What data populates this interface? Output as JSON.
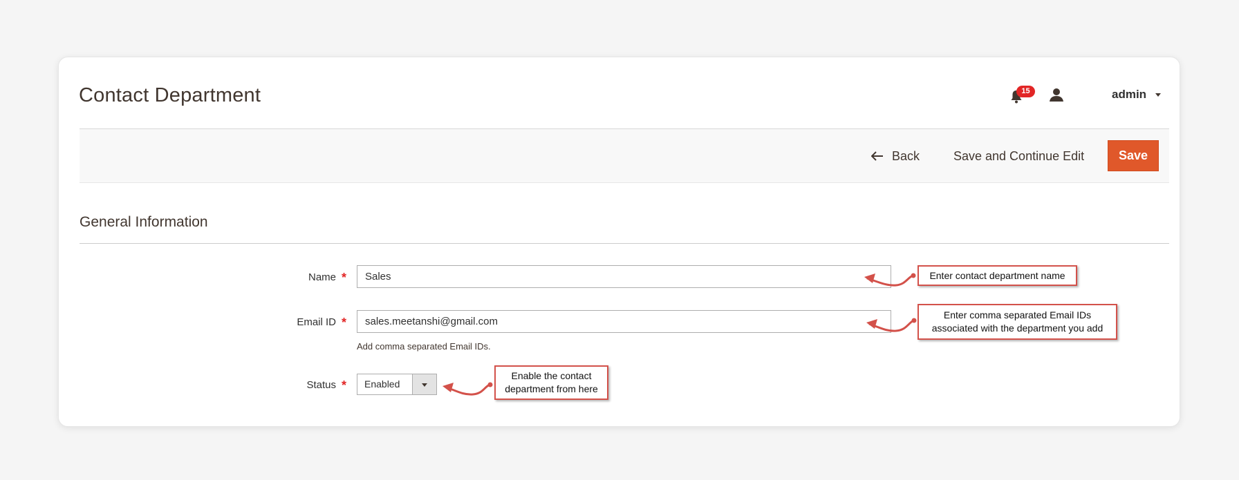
{
  "header": {
    "title": "Contact Department",
    "notifications_count": "15",
    "user_name": "admin"
  },
  "toolbar": {
    "back_label": "Back",
    "save_continue_label": "Save and Continue Edit",
    "save_label": "Save"
  },
  "section": {
    "title": "General Information"
  },
  "form": {
    "name": {
      "label": "Name",
      "value": "Sales"
    },
    "email": {
      "label": "Email ID",
      "value": "sales.meetanshi@gmail.com",
      "note": "Add comma separated Email IDs."
    },
    "status": {
      "label": "Status",
      "value": "Enabled"
    },
    "required_marker": "*"
  },
  "callouts": {
    "name": "Enter contact department name",
    "email_line1": "Enter comma separated Email IDs",
    "email_line2": "associated with the department you add",
    "status_line1": "Enable the contact",
    "status_line2": "department from here"
  },
  "colors": {
    "accent": "#e0582a",
    "badge": "#e22626",
    "callout_border": "#d3514a"
  },
  "icons": {
    "notifications": "bell-icon",
    "user": "user-icon",
    "back": "arrow-left-icon",
    "dropdown": "chevron-down-icon"
  }
}
